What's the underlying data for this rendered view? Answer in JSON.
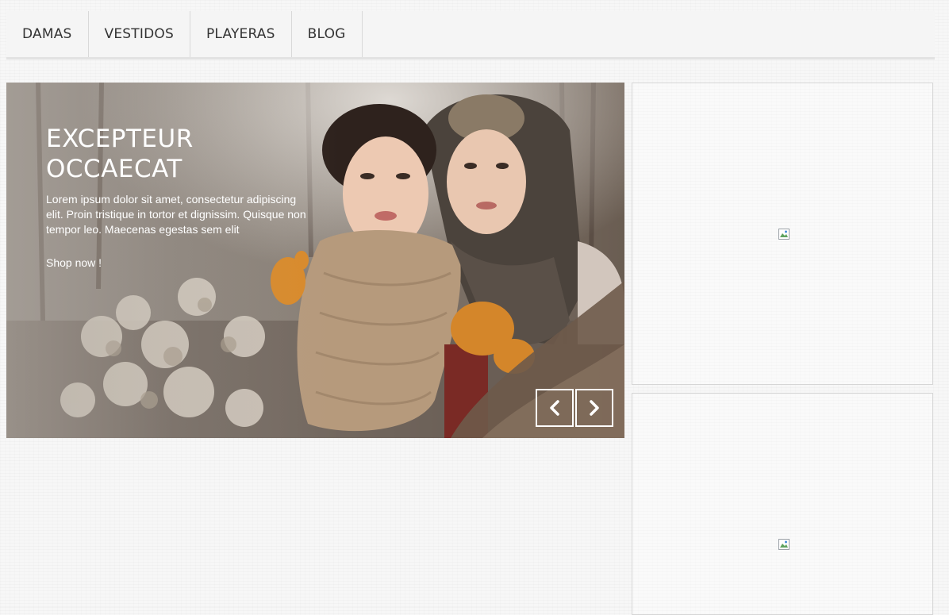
{
  "nav": {
    "items": [
      {
        "label": "DAMAS"
      },
      {
        "label": "VESTIDOS"
      },
      {
        "label": "PLAYERAS"
      },
      {
        "label": "BLOG"
      }
    ]
  },
  "slider": {
    "title": "EXCEPTEUR OCCAECAT",
    "text": "Lorem ipsum dolor sit amet, consectetur adipiscing elit. Proin tristique in tortor et dignissim. Quisque non tempor leo. Maecenas egestas sem elit",
    "link": "Shop now !",
    "prev_icon": "chevron-left-icon",
    "next_icon": "chevron-right-icon"
  },
  "banners": [
    {
      "image": "broken-image-icon"
    },
    {
      "image": "broken-image-icon"
    }
  ],
  "colors": {
    "background": "#f7f7f7",
    "nav_background": "#f5f5f5",
    "caption_text": "#ffffff"
  }
}
